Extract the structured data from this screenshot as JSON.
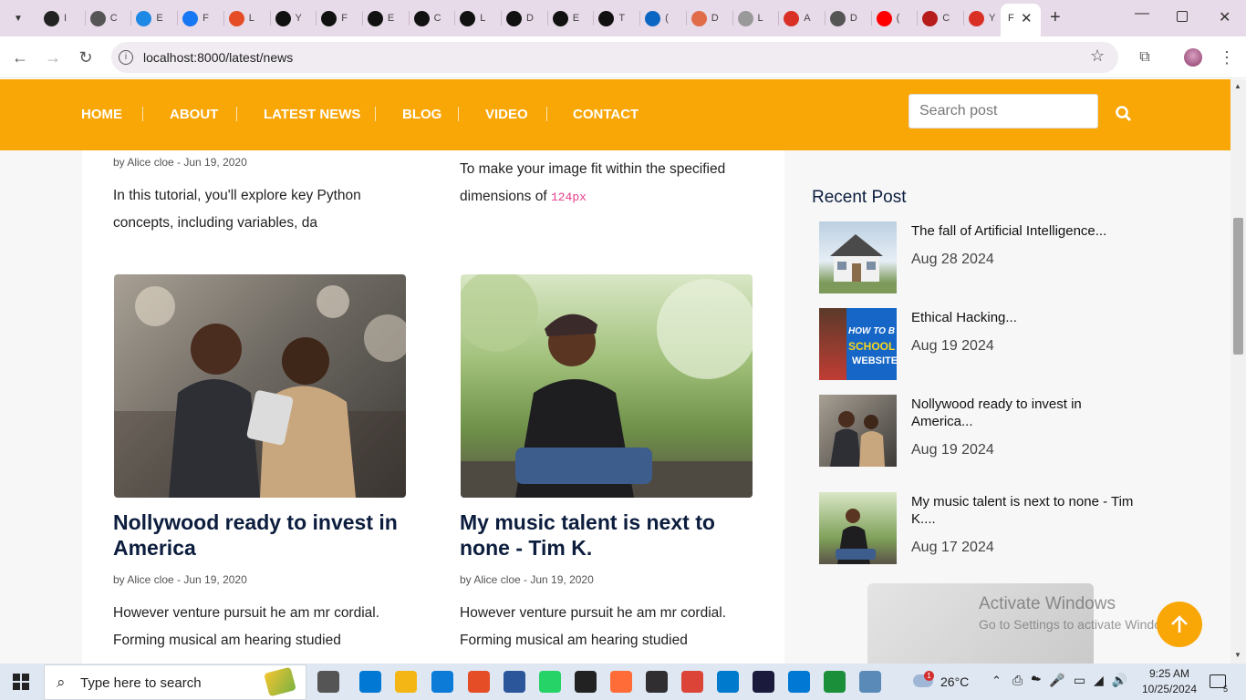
{
  "browser": {
    "tabs": [
      {
        "icon": "chatgpt-icon",
        "letter": "I",
        "color": "#222"
      },
      {
        "icon": "openai-icon",
        "letter": "C",
        "color": "#555"
      },
      {
        "icon": "ef-icon",
        "letter": "E",
        "color": "#1e88e5"
      },
      {
        "icon": "facebook-icon",
        "letter": "F",
        "color": "#1877f2"
      },
      {
        "icon": "html5-icon",
        "letter": "L",
        "color": "#e44d26"
      },
      {
        "icon": "upwork-icon",
        "letter": "Y",
        "color": "#111"
      },
      {
        "icon": "upwork-icon",
        "letter": "F",
        "color": "#111"
      },
      {
        "icon": "upwork-icon",
        "letter": "E",
        "color": "#111"
      },
      {
        "icon": "upwork-icon",
        "letter": "C",
        "color": "#111"
      },
      {
        "icon": "upwork-icon",
        "letter": "L",
        "color": "#111"
      },
      {
        "icon": "upwork-icon",
        "letter": "D",
        "color": "#111"
      },
      {
        "icon": "upwork-icon",
        "letter": "E",
        "color": "#111"
      },
      {
        "icon": "upwork-icon",
        "letter": "T",
        "color": "#111"
      },
      {
        "icon": "linkedin-icon",
        "letter": "(",
        "color": "#0a66c2"
      },
      {
        "icon": "arrow-icon",
        "letter": "D",
        "color": "#e06c4a"
      },
      {
        "icon": "arrow-icon",
        "letter": "L",
        "color": "#999"
      },
      {
        "icon": "gmail-icon",
        "letter": "A",
        "color": "#d93025"
      },
      {
        "icon": "globe-icon",
        "letter": "D",
        "color": "#555"
      },
      {
        "icon": "youtube-icon",
        "letter": "(",
        "color": "#ff0000"
      },
      {
        "icon": "site-icon",
        "letter": "C",
        "color": "#b71c1c"
      },
      {
        "icon": "gmail-icon",
        "letter": "Y",
        "color": "#d93025"
      },
      {
        "icon": "page-icon",
        "letter": "F",
        "color": "#555"
      }
    ],
    "url": "localhost:8000/latest/news"
  },
  "nav": {
    "items": [
      "HOME",
      "ABOUT",
      "LATEST NEWS",
      "BLOG",
      "VIDEO",
      "CONTACT"
    ],
    "search_placeholder": "Search post"
  },
  "posts_top": [
    {
      "meta": "by Alice cloe - Jun 19, 2020",
      "excerpt_line1": "In this tutorial, you'll explore key Python",
      "excerpt_line2": "concepts, including variables, da"
    },
    {
      "excerpt_line1": "To make your image fit within the specified",
      "excerpt_line2": "dimensions of",
      "code": "124px"
    }
  ],
  "posts": [
    {
      "title_line1": "Nollywood ready to invest in",
      "title_line2": "America",
      "meta": "by Alice cloe - Jun 19, 2020",
      "excerpt_line1": "However venture pursuit he am mr cordial.",
      "excerpt_line2": "Forming musical am hearing studied"
    },
    {
      "title_line1": "My music talent is next to",
      "title_line2": "none - Tim K.",
      "meta": "by Alice cloe - Jun 19, 2020",
      "excerpt_line1": "However venture pursuit he am mr cordial.",
      "excerpt_line2": "Forming musical am hearing studied"
    }
  ],
  "sidebar": {
    "heading": "Recent Post",
    "recent": [
      {
        "title_line1": "The fall of Artificial Intelligence...",
        "title_line2": "",
        "date": "Aug 28 2024"
      },
      {
        "title_line1": "Ethical Hacking...",
        "title_line2": "",
        "date": "Aug 19 2024",
        "thumb_text_1": "HOW TO B",
        "thumb_text_2": "SCHOOL",
        "thumb_text_3": "WEBSITE"
      },
      {
        "title_line1": "Nollywood ready to invest in",
        "title_line2": "America...",
        "date": "Aug 19 2024"
      },
      {
        "title_line1": "My music talent is next to none - Tim",
        "title_line2": "K....",
        "date": "Aug 17 2024"
      }
    ]
  },
  "watermark": {
    "line1": "Activate Windows",
    "line2": "Go to Settings to activate Windows."
  },
  "taskbar": {
    "search_placeholder": "Type here to search",
    "weather": "26°C",
    "weather_badge": "1",
    "time": "9:25 AM",
    "date": "10/25/2024",
    "notif_count": "5"
  },
  "colors": {
    "accent": "#f9a607",
    "title": "#0c1d3e",
    "code": "#e83e8c"
  }
}
